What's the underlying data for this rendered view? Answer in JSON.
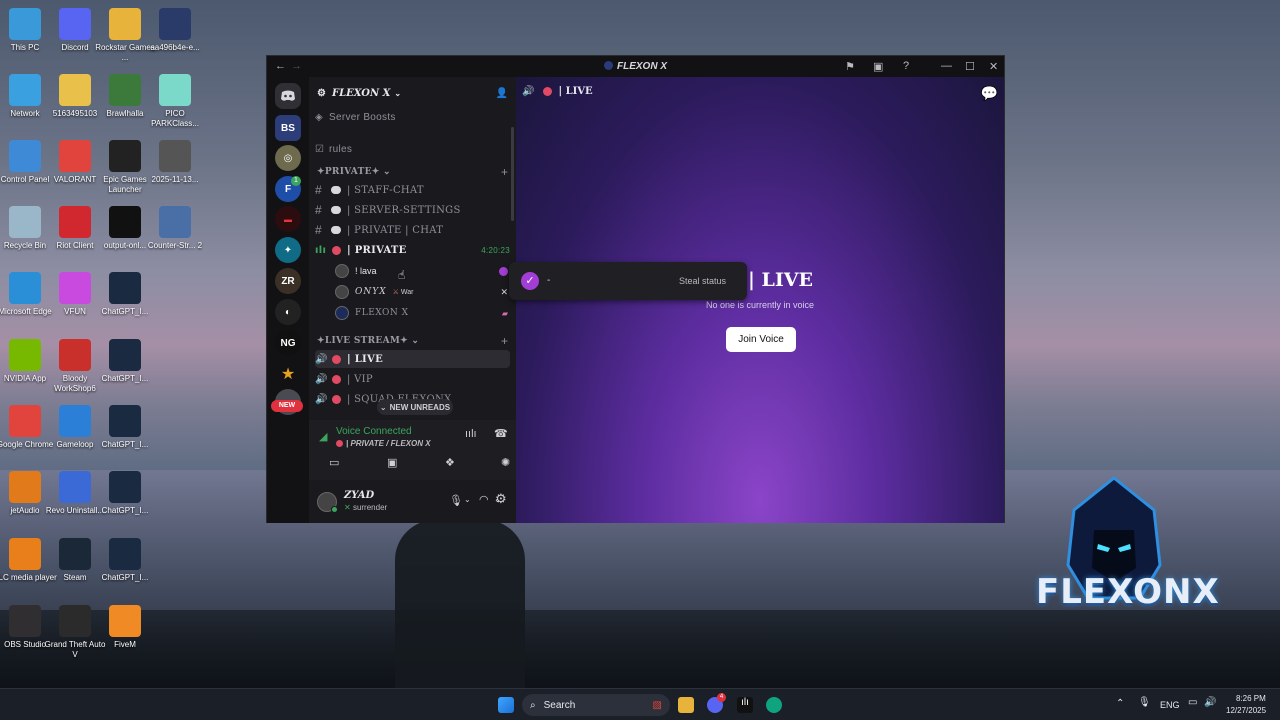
{
  "desktop": {
    "icons": [
      {
        "label": "This PC"
      },
      {
        "label": "Discord"
      },
      {
        "label": "Rockstar Games ..."
      },
      {
        "label": "aa496b4e-e..."
      },
      {
        "label": "Network"
      },
      {
        "label": "5163495103"
      },
      {
        "label": "Brawlhalla"
      },
      {
        "label": "PICO PARKClass..."
      },
      {
        "label": "Control Panel"
      },
      {
        "label": "VALORANT"
      },
      {
        "label": "Epic Games Launcher"
      },
      {
        "label": "2025-11-13..."
      },
      {
        "label": "Recycle Bin"
      },
      {
        "label": "Riot Client"
      },
      {
        "label": "output-onl..."
      },
      {
        "label": "Counter-Str... 2"
      },
      {
        "label": "Microsoft Edge"
      },
      {
        "label": "VFUN"
      },
      {
        "label": "ChatGPT_I..."
      },
      {
        "label": "NVIDIA App"
      },
      {
        "label": "Bloody WorkShop6"
      },
      {
        "label": "ChatGPT_I..."
      },
      {
        "label": "Google Chrome"
      },
      {
        "label": "Gameloop"
      },
      {
        "label": "ChatGPT_I..."
      },
      {
        "label": "jetAudio"
      },
      {
        "label": "Revo Uninstall..."
      },
      {
        "label": "ChatGPT_I..."
      },
      {
        "label": "VLC media player"
      },
      {
        "label": "Steam"
      },
      {
        "label": "ChatGPT_I..."
      },
      {
        "label": "OBS Studio"
      },
      {
        "label": "Grand Theft Auto V"
      },
      {
        "label": "FiveM"
      }
    ],
    "wallpaper_logo_text": "FLEXONX"
  },
  "window": {
    "title": "FLEXON X"
  },
  "servers": {
    "new_badge": "NEW",
    "notification_count": "1"
  },
  "channels": {
    "server_name": "FLEXON X",
    "server_boosts": "Server Boosts",
    "rules": "rules",
    "category_private": "✦PRIVATE✦",
    "staff_chat": "| STAFF-CHAT",
    "server_settings": "| SERVER-SETTINGS",
    "private_chat": "| PRIVATE | CHAT",
    "private_voice": "| PRIVATE",
    "private_timer": "4:20:23",
    "users": [
      {
        "name": "! lava",
        "tag": ""
      },
      {
        "name": "ONYX",
        "tag": "War"
      },
      {
        "name": "FLEXON X",
        "tag": ""
      }
    ],
    "category_live": "✦LIVE STREAM✦",
    "live": "| LIVE",
    "vip": "| VIP",
    "squad": "| SQUAD FLEXONX",
    "new_unreads": "NEW UNREADS"
  },
  "voice_connected": {
    "status": "Voice Connected",
    "location": "| PRIVATE / FLEXON X"
  },
  "user_panel": {
    "name": "ZYAD",
    "status": "surrender"
  },
  "main": {
    "header_channel": "| LIVE",
    "center_title": "| LIVE",
    "center_subtitle": "No one is currently in voice",
    "join_button": "Join Voice"
  },
  "popup": {
    "status_text": "-",
    "action": "Steal status"
  },
  "taskbar": {
    "search_placeholder": "Search",
    "lang": "ENG",
    "time": "8:26 PM",
    "date": "12/27/2025",
    "discord_badge": "4"
  },
  "colors": {
    "accent_green": "#3ba55d",
    "live_dot": "#e04a63",
    "purple_badge": "#a23dd6"
  }
}
